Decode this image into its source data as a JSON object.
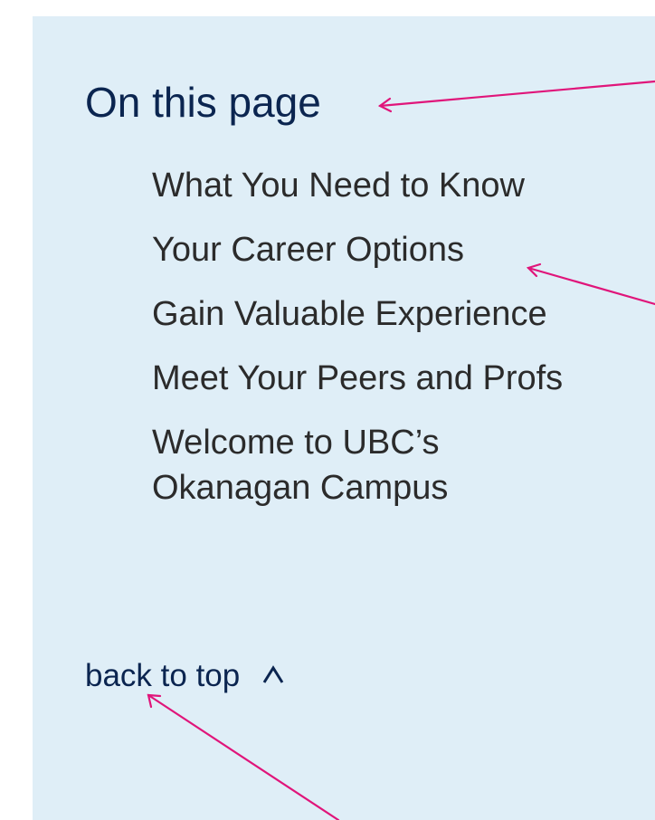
{
  "toc": {
    "title": "On this page",
    "items": [
      "What You Need to Know",
      "Your Career Options",
      "Gain Valuable Experience",
      "Meet Your Peers and Profs",
      "Welcome to UBC’s Okanagan Campus"
    ]
  },
  "footer": {
    "back_to_top_label": "back to top",
    "back_to_top_icon": "chevron-up-icon"
  },
  "colors": {
    "panel_background": "#dfeef7",
    "heading": "#0b2550",
    "link": "#2b2b2b",
    "annotation_arrow": "#e0157a"
  }
}
